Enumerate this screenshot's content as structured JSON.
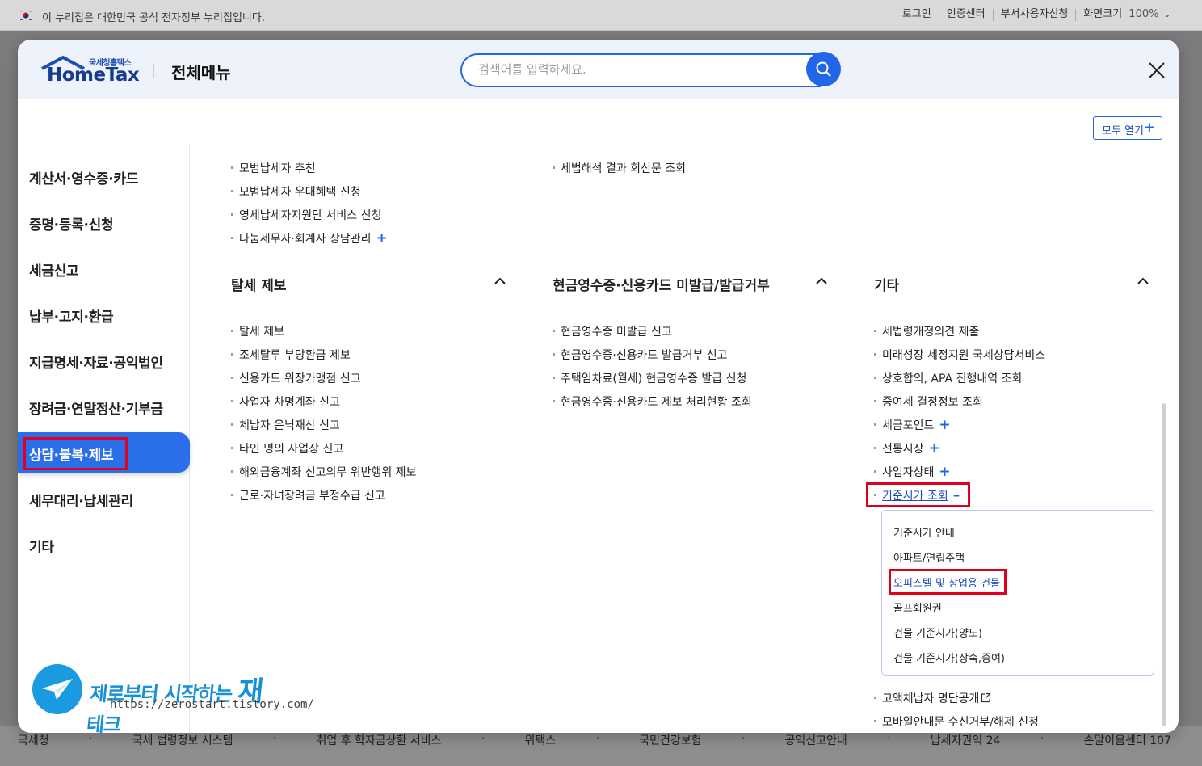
{
  "gov_banner": {
    "text": "이 누리집은 대한민국 공식 전자정부 누리집입니다.",
    "links": [
      "로그인",
      "인증센터",
      "부서사용자신청",
      "화면크기"
    ],
    "zoom": "100%"
  },
  "footer": {
    "links": [
      "국세청",
      "국세 법령정보 시스템",
      "취업 후 학자금상환 서비스",
      "위택스",
      "국민건강보험",
      "공익신고안내",
      "납세자권익 24",
      "손말이음센터 107"
    ],
    "separator": "·"
  },
  "header": {
    "logo_small": "국세청홈택스",
    "logo_main": "HomeTax",
    "title": "전체메뉴",
    "search_placeholder": "검색어를 입력하세요."
  },
  "open_all": {
    "label": "모두 열기",
    "icon": "+"
  },
  "left_nav": [
    "계산서·영수증·카드",
    "증명·등록·신청",
    "세금신고",
    "납부·고지·환급",
    "지급명세·자료·공익법인",
    "장려금·연말정산·기부금",
    "상담·불복·제보",
    "세무대리·납세관리",
    "기타"
  ],
  "top_links_col1": [
    "모범납세자 추천",
    "모범납세자 우대혜택 신청",
    "영세납세자지원단 서비스 신청",
    "나눔세무사·회계사 상담관리"
  ],
  "top_links_col2": [
    "세법해석 결과 회신문 조회"
  ],
  "sections": {
    "s1": {
      "title": "탈세 제보",
      "items": [
        "탈세 제보",
        "조세탈루 부당환급 제보",
        "신용카드 위장가맹점 신고",
        "사업자 차명계좌 신고",
        "체납자 은닉재산 신고",
        "타인 명의 사업장 신고",
        "해외금융계좌 신고의무 위반행위 제보",
        "근로·자녀장려금 부정수급 신고"
      ]
    },
    "s2": {
      "title": "현금영수증·신용카드 미발급/발급거부",
      "items": [
        "현금영수증 미발급 신고",
        "현금영수증·신용카드 발급거부 신고",
        "주택임차료(월세) 현금영수증 발급 신청",
        "현금영수증·신용카드 제보 처리현황 조회"
      ]
    },
    "s3": {
      "title": "기타",
      "items": [
        "세법령개정의견 제출",
        "미래성장 세정지원 국세상담서비스",
        "상호합의, APA 진행내역 조회",
        "증여세 결정정보 조회",
        "세금포인트",
        "전통시장",
        "사업자상태",
        "기준시가 조회"
      ],
      "sub_items": [
        "기준시가 안내",
        "아파트/연립주택",
        "오피스텔 및 상업용 건물",
        "골프회원권",
        "건물 기준시가(양도)",
        "건물 기준시가(상속,증여)"
      ],
      "after_items": [
        "고액체납자 명단공개",
        "모바일안내문 수신거부/해제 신청"
      ]
    }
  },
  "plus_sign": "+",
  "minus_sign": "–",
  "watermark": {
    "title_a": "제로부터 시작하는 ",
    "title_b": "재",
    "title_c": "테크",
    "url": "https://zerostart.tistory.com/"
  },
  "colors": {
    "accent": "#2166e8",
    "active_nav": "#2b6ee9",
    "highlight": "#e0001b"
  }
}
